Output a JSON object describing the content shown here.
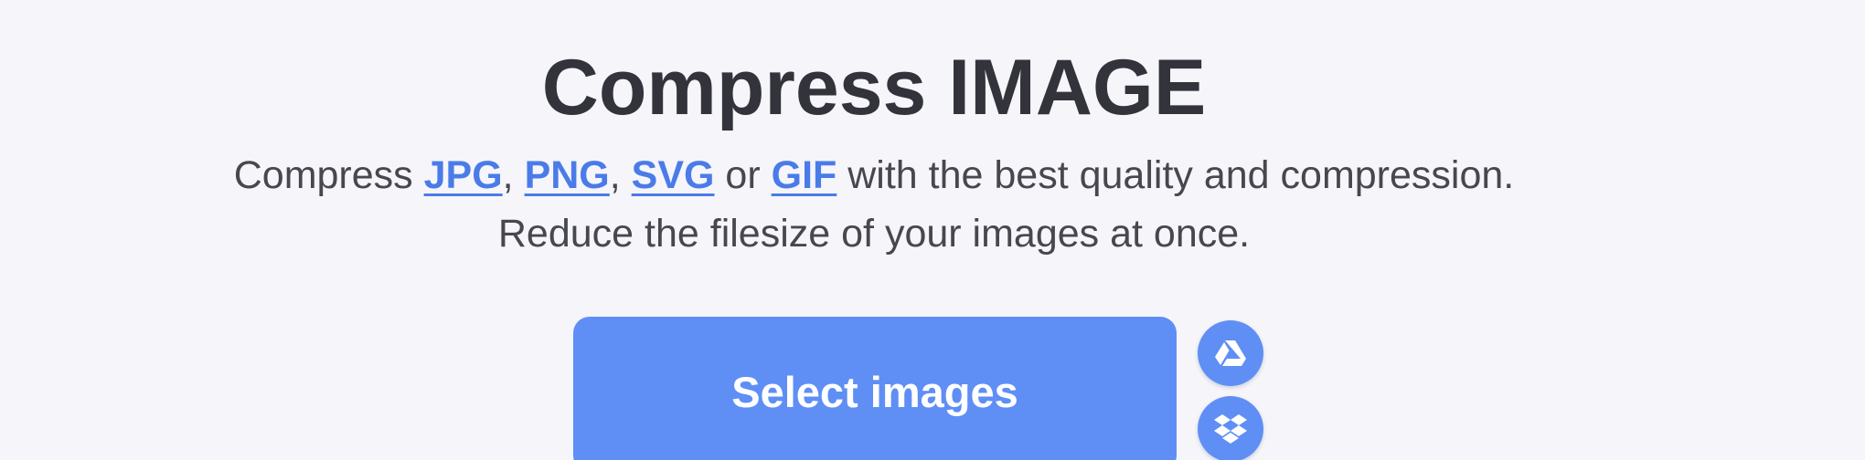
{
  "header": {
    "title": "Compress IMAGE"
  },
  "subtitle": {
    "prefix": "Compress ",
    "links": [
      "JPG",
      "PNG",
      "SVG",
      "GIF"
    ],
    "sep_comma": ", ",
    "sep_or": " or ",
    "suffix": " with the best quality and compression.",
    "line2": "Reduce the filesize of your images at once."
  },
  "upload": {
    "select_label": "Select images",
    "cloud_buttons": [
      {
        "icon": "google-drive-icon"
      },
      {
        "icon": "dropbox-icon"
      }
    ]
  },
  "colors": {
    "background": "#f5f5fa",
    "accent": "#5f8ff5",
    "link": "#4a7be8",
    "title": "#33333b",
    "text": "#47474f"
  }
}
